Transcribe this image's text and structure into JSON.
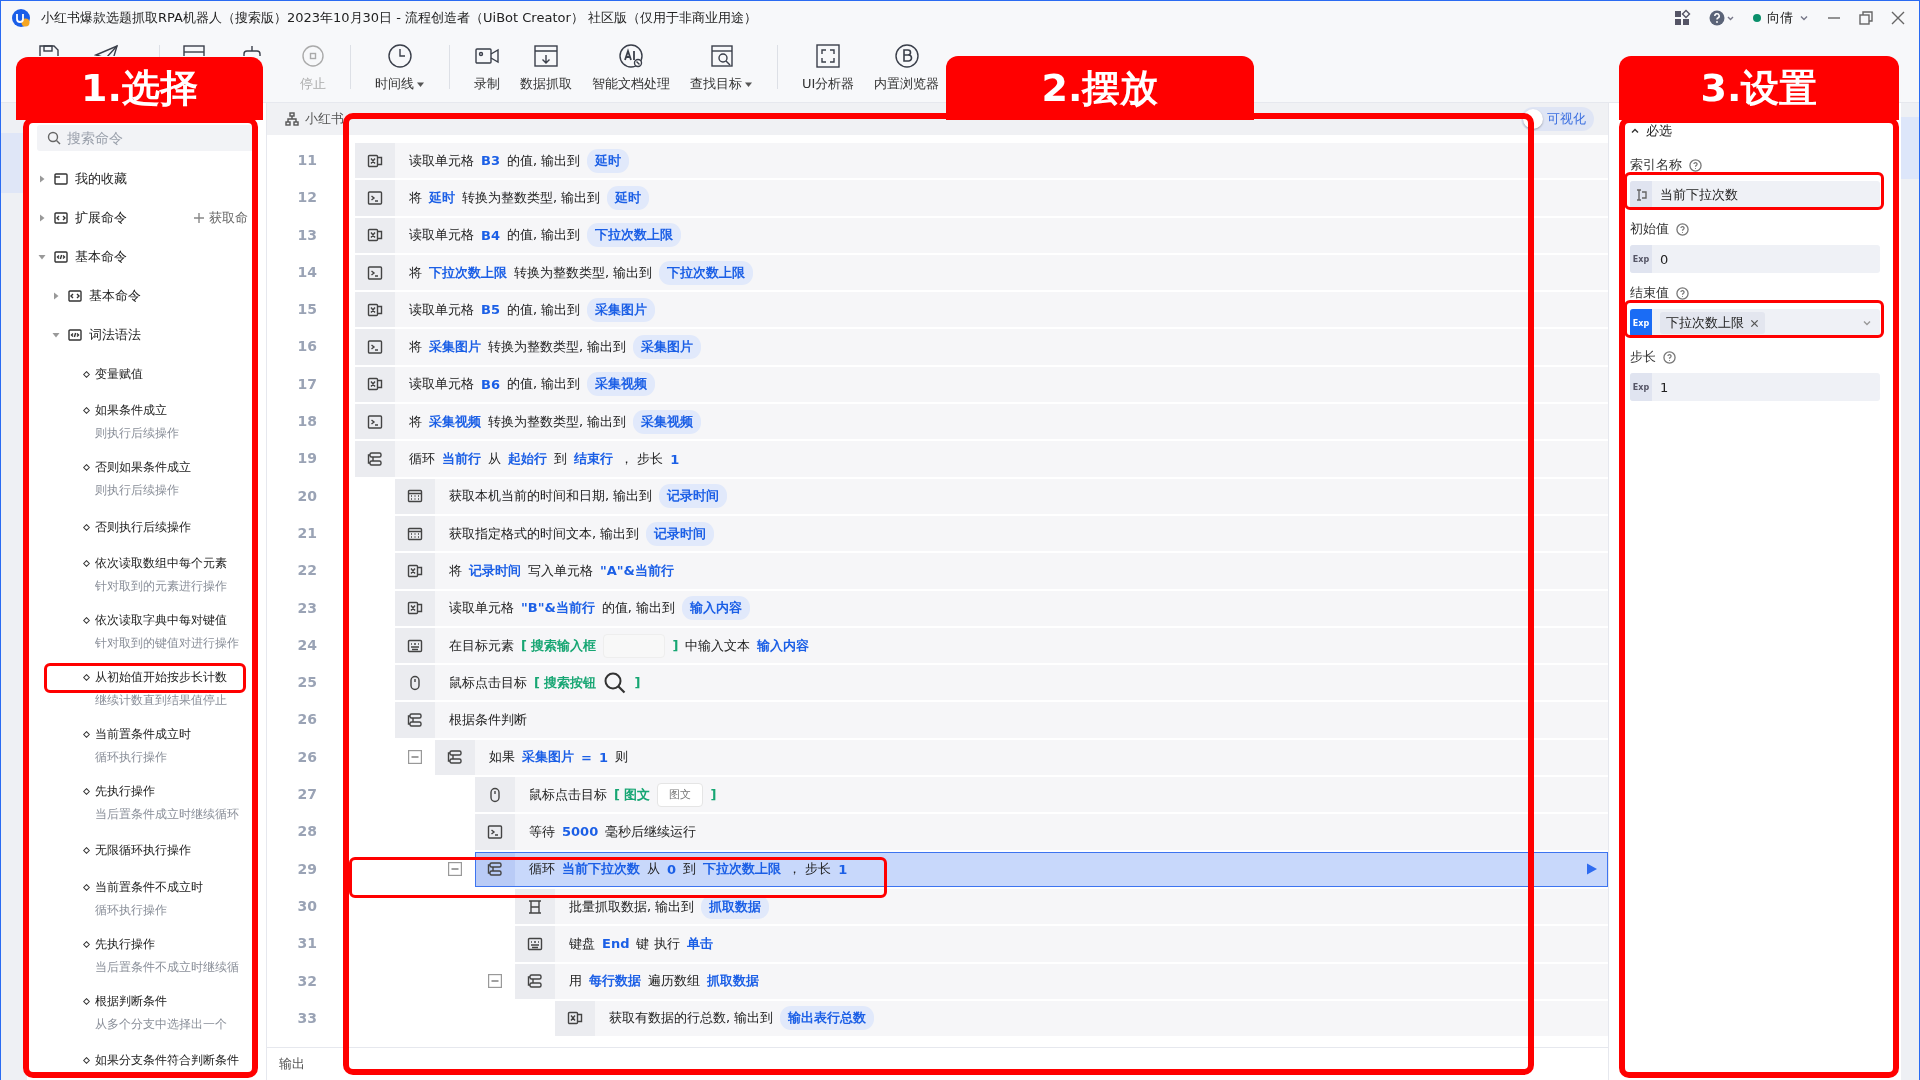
{
  "window": {
    "title": "小红书爆款选题抓取RPA机器人（搜索版）2023年10月30日 - 流程创造者（UiBot Creator） 社区版（仅用于非商业用途）",
    "user": {
      "name": "向倩",
      "online": true
    }
  },
  "toolbar": {
    "items": [
      {
        "label": "停止",
        "disabled": true,
        "dropdown": false
      },
      {
        "label": "时间线",
        "disabled": false,
        "dropdown": true
      },
      {
        "label": "录制",
        "disabled": false,
        "dropdown": false
      },
      {
        "label": "数据抓取",
        "disabled": false,
        "dropdown": false
      },
      {
        "label": "智能文档处理",
        "disabled": false,
        "dropdown": false
      },
      {
        "label": "查找目标",
        "disabled": false,
        "dropdown": true
      },
      {
        "label": "UI分析器",
        "disabled": false,
        "dropdown": false
      },
      {
        "label": "内置浏览器",
        "disabled": false,
        "dropdown": false
      }
    ]
  },
  "commands": {
    "search": {
      "placeholder": "搜索命令"
    },
    "tree": [
      {
        "label": "我的收藏",
        "expanded": false
      },
      {
        "label": "扩展命令",
        "expanded": false,
        "action": "获取命"
      },
      {
        "label": "基本命令",
        "expanded": true,
        "children": [
          {
            "label": "基本命令",
            "expanded": false
          },
          {
            "label": "词法语法",
            "expanded": true,
            "children": [
              {
                "label": "变量赋值"
              },
              {
                "label": "如果条件成立",
                "desc": "则执行后续操作"
              },
              {
                "label": "否则如果条件成立",
                "desc": "则执行后续操作"
              },
              {
                "label": "否则执行后续操作"
              },
              {
                "label": "依次读取数组中每个元素",
                "desc": "针对取到的元素进行操作"
              },
              {
                "label": "依次读取字典中每对键值",
                "desc": "针对取到的键值对进行操作"
              },
              {
                "label": "从初始值开始按步长计数",
                "desc": "继续计数直到结果值停止"
              },
              {
                "label": "当前置条件成立时",
                "desc": "循环执行操作"
              },
              {
                "label": "先执行操作",
                "desc": "当后置条件成立时继续循环"
              },
              {
                "label": "无限循环执行操作"
              },
              {
                "label": "当前置条件不成立时",
                "desc": "循环执行操作"
              },
              {
                "label": "先执行操作",
                "desc": "当后置条件不成立时继续循"
              },
              {
                "label": "根据判断条件",
                "desc": "从多个分支中选择出一个"
              },
              {
                "label": "如果分支条件符合判断条件"
              }
            ]
          }
        ]
      }
    ]
  },
  "editor": {
    "tab": {
      "label": "小红书"
    },
    "visual_toggle": {
      "label": "可视化",
      "on": false
    },
    "rows": [
      {
        "line": "11",
        "kind": "excel",
        "selected": false,
        "parts": [
          {
            "kind": "text",
            "text": "读取单元格"
          },
          {
            "kind": "var",
            "text": "B3"
          },
          {
            "kind": "text",
            "text": "的值, 输出到"
          },
          {
            "kind": "chip",
            "text": "延时"
          }
        ]
      },
      {
        "line": "12",
        "kind": "terminal",
        "selected": false,
        "parts": [
          {
            "kind": "text",
            "text": "将"
          },
          {
            "kind": "var",
            "text": "延时"
          },
          {
            "kind": "text",
            "text": "转换为整数类型, 输出到"
          },
          {
            "kind": "chip",
            "text": "延时"
          }
        ]
      },
      {
        "line": "13",
        "kind": "excel",
        "selected": false,
        "parts": [
          {
            "kind": "text",
            "text": "读取单元格"
          },
          {
            "kind": "var",
            "text": "B4"
          },
          {
            "kind": "text",
            "text": "的值, 输出到"
          },
          {
            "kind": "chip",
            "text": "下拉次数上限"
          }
        ]
      },
      {
        "line": "14",
        "kind": "terminal",
        "selected": false,
        "parts": [
          {
            "kind": "text",
            "text": "将"
          },
          {
            "kind": "var",
            "text": "下拉次数上限"
          },
          {
            "kind": "text",
            "text": "转换为整数类型, 输出到"
          },
          {
            "kind": "chip",
            "text": "下拉次数上限"
          }
        ]
      },
      {
        "line": "15",
        "kind": "excel",
        "selected": false,
        "parts": [
          {
            "kind": "text",
            "text": "读取单元格"
          },
          {
            "kind": "var",
            "text": "B5"
          },
          {
            "kind": "text",
            "text": "的值, 输出到"
          },
          {
            "kind": "chip",
            "text": "采集图片"
          }
        ]
      },
      {
        "line": "16",
        "kind": "terminal",
        "selected": false,
        "parts": [
          {
            "kind": "text",
            "text": "将"
          },
          {
            "kind": "var",
            "text": "采集图片"
          },
          {
            "kind": "text",
            "text": "转换为整数类型, 输出到"
          },
          {
            "kind": "chip",
            "text": "采集图片"
          }
        ]
      },
      {
        "line": "17",
        "kind": "excel",
        "selected": false,
        "parts": [
          {
            "kind": "text",
            "text": "读取单元格"
          },
          {
            "kind": "var",
            "text": "B6"
          },
          {
            "kind": "text",
            "text": "的值, 输出到"
          },
          {
            "kind": "chip",
            "text": "采集视频"
          }
        ]
      },
      {
        "line": "18",
        "kind": "terminal",
        "selected": false,
        "parts": [
          {
            "kind": "text",
            "text": "将"
          },
          {
            "kind": "var",
            "text": "采集视频"
          },
          {
            "kind": "text",
            "text": "转换为整数类型, 输出到"
          },
          {
            "kind": "chip",
            "text": "采集视频"
          }
        ]
      },
      {
        "line": "19",
        "kind": "loop",
        "selected": false,
        "parts": [
          {
            "kind": "text",
            "text": "循环"
          },
          {
            "kind": "var",
            "text": "当前行"
          },
          {
            "kind": "text",
            "text": "从"
          },
          {
            "kind": "var",
            "text": "起始行"
          },
          {
            "kind": "text",
            "text": "到"
          },
          {
            "kind": "var",
            "text": "结束行"
          },
          {
            "kind": "text",
            "text": "，  步长"
          },
          {
            "kind": "var",
            "text": "1"
          }
        ],
        "children": [
          {
            "line": "20",
            "kind": "calendar",
            "selected": false,
            "parts": [
              {
                "kind": "text",
                "text": "获取本机当前的时间和日期, 输出到"
              },
              {
                "kind": "chip",
                "text": "记录时间"
              }
            ]
          },
          {
            "line": "21",
            "kind": "calendar",
            "selected": false,
            "parts": [
              {
                "kind": "text",
                "text": "获取指定格式的时间文本, 输出到"
              },
              {
                "kind": "chip",
                "text": "记录时间"
              }
            ]
          },
          {
            "line": "22",
            "kind": "excel",
            "selected": false,
            "parts": [
              {
                "kind": "text",
                "text": "将"
              },
              {
                "kind": "var",
                "text": "记录时间"
              },
              {
                "kind": "text",
                "text": "写入单元格"
              },
              {
                "kind": "var",
                "text": "\"A\"&当前行"
              }
            ]
          },
          {
            "line": "23",
            "kind": "excel",
            "selected": false,
            "parts": [
              {
                "kind": "text",
                "text": "读取单元格"
              },
              {
                "kind": "var",
                "text": "\"B\"&当前行"
              },
              {
                "kind": "text",
                "text": "的值, 输出到"
              },
              {
                "kind": "chip",
                "text": "输入内容"
              }
            ]
          },
          {
            "line": "24",
            "kind": "keyboard",
            "selected": false,
            "parts": [
              {
                "kind": "text",
                "text": "在目标元素"
              },
              {
                "kind": "target",
                "text": "[ 搜索输入框"
              },
              {
                "kind": "thumb"
              },
              {
                "kind": "target",
                "text": "]"
              },
              {
                "kind": "text",
                "text": "中输入文本"
              },
              {
                "kind": "var",
                "text": "输入内容"
              }
            ]
          },
          {
            "line": "25",
            "kind": "mouse",
            "selected": false,
            "parts": [
              {
                "kind": "text",
                "text": "鼠标点击目标"
              },
              {
                "kind": "target",
                "text": "[ 搜索按钮"
              },
              {
                "kind": "search-thumb"
              },
              {
                "kind": "target",
                "text": "]"
              }
            ]
          },
          {
            "line": "26",
            "kind": "loop",
            "selected": false,
            "parts": [
              {
                "kind": "text",
                "text": "根据条件判断"
              }
            ],
            "children": [
              {
                "line": "26",
                "kind": "loop",
                "selected": false,
                "expanded": true,
                "parts": [
                  {
                    "kind": "text",
                    "text": "如果"
                  },
                  {
                    "kind": "var",
                    "text": "采集图片"
                  },
                  {
                    "kind": "var",
                    "text": "="
                  },
                  {
                    "kind": "var",
                    "text": "1"
                  },
                  {
                    "kind": "text",
                    "text": "则"
                  }
                ],
                "children": [
                  {
                    "line": "27",
                    "kind": "mouse",
                    "selected": false,
                    "parts": [
                      {
                        "kind": "text",
                        "text": "鼠标点击目标"
                      },
                      {
                        "kind": "target",
                        "text": "[ 图文"
                      },
                      {
                        "kind": "thumb",
                        "text": "图文"
                      },
                      {
                        "kind": "target",
                        "text": "]"
                      }
                    ]
                  },
                  {
                    "line": "28",
                    "kind": "terminal",
                    "selected": false,
                    "parts": [
                      {
                        "kind": "text",
                        "text": "等待"
                      },
                      {
                        "kind": "var",
                        "text": "5000"
                      },
                      {
                        "kind": "text",
                        "text": "毫秒后继续运行"
                      }
                    ]
                  },
                  {
                    "line": "29",
                    "kind": "loop",
                    "selected": true,
                    "expanded": true,
                    "parts": [
                      {
                        "kind": "text",
                        "text": "循环"
                      },
                      {
                        "kind": "var",
                        "text": "当前下拉次数"
                      },
                      {
                        "kind": "text",
                        "text": "从"
                      },
                      {
                        "kind": "var",
                        "text": "0"
                      },
                      {
                        "kind": "text",
                        "text": "到"
                      },
                      {
                        "kind": "var",
                        "text": "下拉次数上限"
                      },
                      {
                        "kind": "text",
                        "text": "，  步长"
                      },
                      {
                        "kind": "var",
                        "text": "1"
                      }
                    ],
                    "children": [
                      {
                        "line": "30",
                        "kind": "grid",
                        "selected": false,
                        "parts": [
                          {
                            "kind": "text",
                            "text": "批量抓取数据, 输出到"
                          },
                          {
                            "kind": "chip",
                            "text": "抓取数据"
                          }
                        ]
                      },
                      {
                        "line": "31",
                        "kind": "keyboard",
                        "selected": false,
                        "parts": [
                          {
                            "kind": "text",
                            "text": "键盘"
                          },
                          {
                            "kind": "var",
                            "text": "End"
                          },
                          {
                            "kind": "text",
                            "text": "键 执行"
                          },
                          {
                            "kind": "var",
                            "text": "单击"
                          }
                        ]
                      },
                      {
                        "line": "32",
                        "kind": "loop",
                        "selected": false,
                        "expanded": true,
                        "parts": [
                          {
                            "kind": "text",
                            "text": "用"
                          },
                          {
                            "kind": "var",
                            "text": "每行数据"
                          },
                          {
                            "kind": "text",
                            "text": "遍历数组"
                          },
                          {
                            "kind": "var",
                            "text": "抓取数据"
                          }
                        ],
                        "children": [
                          {
                            "line": "33",
                            "kind": "excel",
                            "selected": false,
                            "parts": [
                              {
                                "kind": "text",
                                "text": "获取有数据的行总数, 输出到"
                              },
                              {
                                "kind": "chip",
                                "text": "输出表行总数"
                              }
                            ]
                          }
                        ]
                      }
                    ]
                  }
                ]
              }
            ]
          }
        ]
      }
    ],
    "footer": {
      "tab": "输出"
    }
  },
  "properties": {
    "section": {
      "title": "必选",
      "expanded": true
    },
    "fields": [
      {
        "kind": "var",
        "label": "索引名称",
        "value": "当前下拉次数"
      },
      {
        "kind": "exp",
        "label": "初始值",
        "prefix": "Exp",
        "prefix_active": false,
        "value": "0"
      },
      {
        "kind": "chip",
        "label": "结束值",
        "prefix": "Exp",
        "prefix_active": true,
        "chip": "下拉次数上限"
      },
      {
        "kind": "exp",
        "label": "步长",
        "prefix": "Exp",
        "prefix_active": false,
        "value": "1"
      }
    ]
  },
  "callouts": [
    {
      "label": "1.选择"
    },
    {
      "label": "2.摆放"
    },
    {
      "label": "3.设置"
    }
  ]
}
